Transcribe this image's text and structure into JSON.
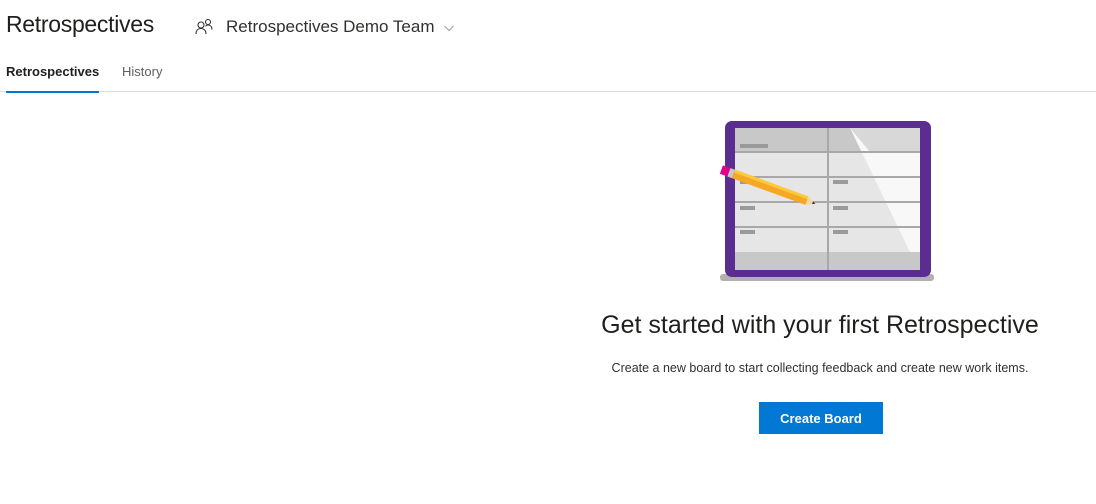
{
  "header": {
    "title": "Retrospectives",
    "team_icon": "people-icon",
    "team_name": "Retrospectives Demo Team",
    "team_chevron": "chevron-down-icon"
  },
  "tabs": [
    {
      "label": "Retrospectives",
      "active": true
    },
    {
      "label": "History",
      "active": false
    }
  ],
  "empty_state": {
    "illustration": "retrospective-board-illustration",
    "title": "Get started with your first Retrospective",
    "description": "Create a new board to start collecting feedback and create new work items.",
    "button_label": "Create Board"
  },
  "colors": {
    "accent": "#0078d4",
    "board_frame": "#5c2d91",
    "pencil": "#f7a823"
  }
}
